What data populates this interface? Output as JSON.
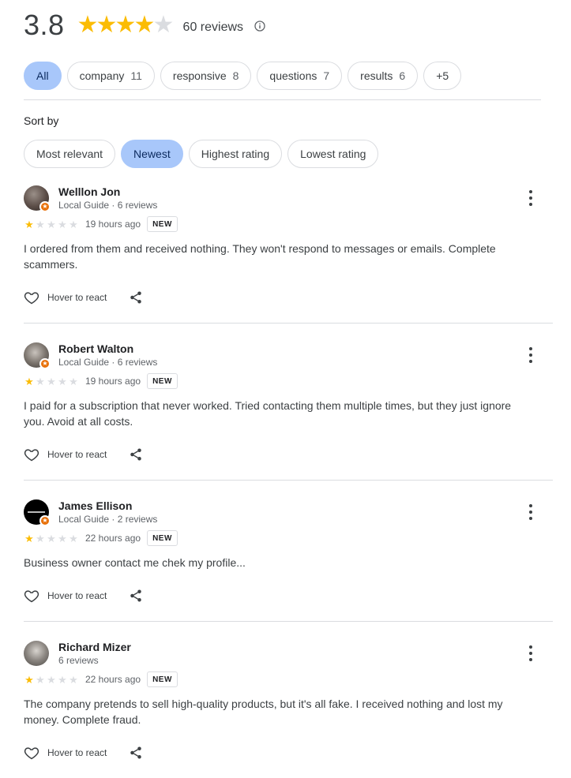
{
  "summary": {
    "rating": "3.8",
    "stars_filled": 4,
    "review_count": "60 reviews",
    "star_color": "#fbbc04",
    "star_empty_color": "#dadce0"
  },
  "topic_chips": [
    {
      "label": "All",
      "count": "",
      "selected": true
    },
    {
      "label": "company",
      "count": "11",
      "selected": false
    },
    {
      "label": "responsive",
      "count": "8",
      "selected": false
    },
    {
      "label": "questions",
      "count": "7",
      "selected": false
    },
    {
      "label": "results",
      "count": "6",
      "selected": false
    },
    {
      "label": "+5",
      "count": "",
      "selected": false
    }
  ],
  "sort": {
    "label": "Sort by",
    "options": [
      {
        "label": "Most relevant",
        "selected": false
      },
      {
        "label": "Newest",
        "selected": true
      },
      {
        "label": "Highest rating",
        "selected": false
      },
      {
        "label": "Lowest rating",
        "selected": false
      }
    ]
  },
  "reviews": [
    {
      "name": "Welllon Jon",
      "meta": "Local Guide · 6 reviews",
      "rating": 1,
      "time": "19 hours ago",
      "badge": "NEW",
      "text": "I ordered from them and received nothing. They won't respond to messages or emails. Complete scammers.",
      "react_label": "Hover to react"
    },
    {
      "name": "Robert Walton",
      "meta": "Local Guide · 6 reviews",
      "rating": 1,
      "time": "19 hours ago",
      "badge": "NEW",
      "text": "I paid for a subscription that never worked. Tried contacting them multiple times, but they just ignore you. Avoid at all costs.",
      "react_label": "Hover to react"
    },
    {
      "name": "James Ellison",
      "meta": "Local Guide · 2 reviews",
      "rating": 1,
      "time": "22 hours ago",
      "badge": "NEW",
      "text": "Business owner contact me chek my profile...",
      "react_label": "Hover to react"
    },
    {
      "name": "Richard Mizer",
      "meta": "6 reviews",
      "rating": 1,
      "time": "22 hours ago",
      "badge": "NEW",
      "text": "The company pretends to sell high-quality products, but it's all fake. I received nothing and lost my money. Complete fraud.",
      "react_label": "Hover to react"
    }
  ]
}
